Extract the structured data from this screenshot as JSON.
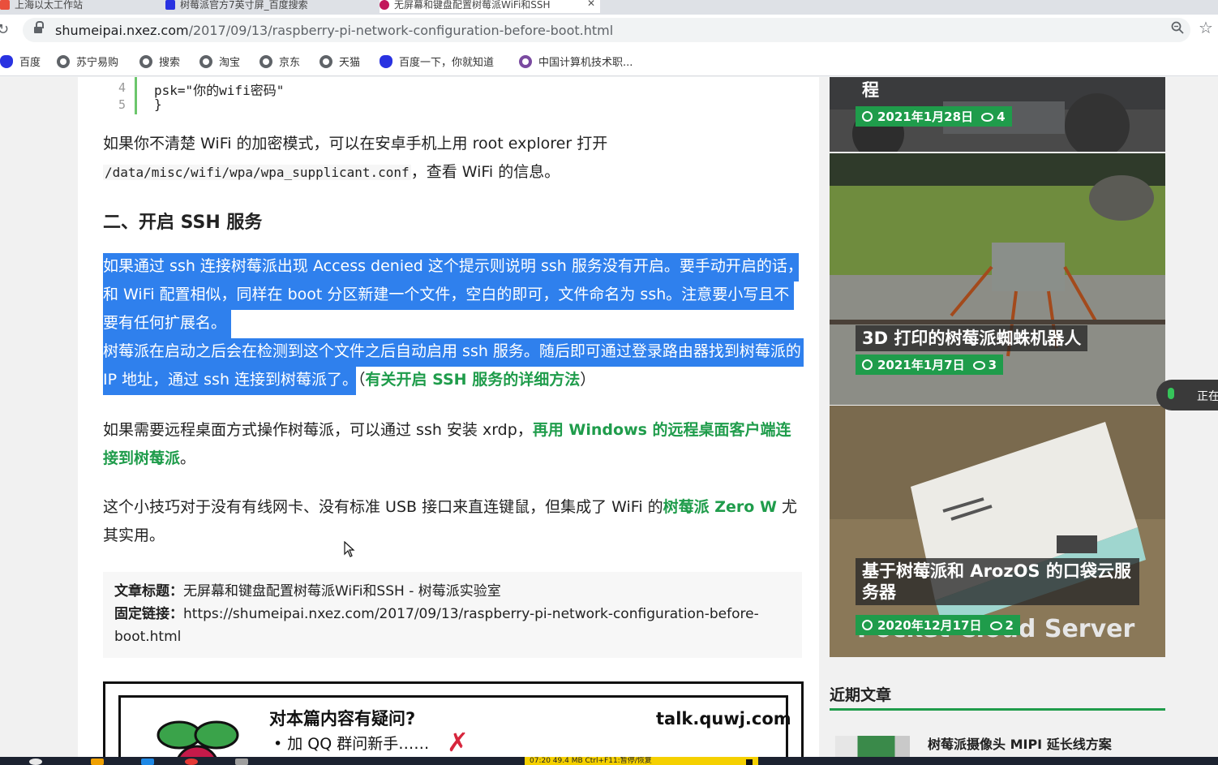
{
  "browser": {
    "tabs": [
      {
        "label": "上海以太工作站"
      },
      {
        "label": "树莓派官方7英寸屏_百度搜索"
      },
      {
        "label": "无屏幕和键盘配置树莓派WiFi和SSH"
      }
    ],
    "url_host": "shumeipai.nxez.com",
    "url_path": "/2017/09/13/raspberry-pi-network-configuration-before-boot.html",
    "bookmarks": [
      "百度",
      "苏宁易购",
      "搜索",
      "淘宝",
      "京东",
      "天猫",
      "百度一下，你就知道",
      "中国计算机技术职..."
    ]
  },
  "article": {
    "code_lines": [
      {
        "num": "4",
        "text": "psk=\"你的wifi密码\""
      },
      {
        "num": "5",
        "text": "}"
      }
    ],
    "para_wifi_1": "如果你不清楚 WiFi 的加密模式，可以在安卓手机上用 root explorer 打开",
    "para_wifi_path": "/data/misc/wifi/wpa/wpa_supplicant.conf",
    "para_wifi_2": "，查看 WiFi 的信息。",
    "heading": "二、开启 SSH 服务",
    "hl_line1": "如果通过 ssh 连接树莓派出现 Access denied 这个提示则说明 ssh 服务没有开启。要手动开启的话，",
    "hl_line2": "和 WiFi 配置相似，同样在 boot 分区新建一个文件，空白的即可，文件命名为 ssh。注意要小写且不",
    "hl_line3": "要有任何扩展名。",
    "hl_line4": "树莓派在启动之后会在检测到这个文件之后自动启用 ssh 服务。随后即可通过登录路由器找到树莓派的",
    "hl_line5": "IP 地址，通过 ssh 连接到树莓派了。",
    "ssh_link_open": "（",
    "ssh_link": "有关开启 SSH 服务的详细方法",
    "ssh_link_close": "）",
    "para_xrdp": "如果需要远程桌面方式操作树莓派，可以通过 ssh 安装 xrdp，",
    "xrdp_link": "再用 Windows 的远程桌面客户端连接到树莓派",
    "xrdp_end": "。",
    "para_tip_1": "这个小技巧对于没有有线网卡、没有标准 USB 接口来直连键鼠，但集成了 WiFi 的",
    "tip_link": "树莓派 Zero W",
    "para_tip_2": " 尤其实用。",
    "meta_title_label": "文章标题：",
    "meta_title": "无屏幕和键盘配置树莓派WiFi和SSH - 树莓派实验室",
    "meta_link_label": "固定链接：",
    "meta_link": "https://shumeipai.nxez.com/2017/09/13/raspberry-pi-network-configuration-before-boot.html",
    "question_title": "对本篇内容有疑问?",
    "question_item": "• 加 QQ 群问新手……",
    "question_site": "talk.quwj.com"
  },
  "sidebar": {
    "cards": [
      {
        "title": "程",
        "date": "2021年1月28日",
        "comments": "4"
      },
      {
        "title": "3D 打印的树莓派蜘蛛机器人",
        "date": "2021年1月7日",
        "comments": "3"
      },
      {
        "title": "基于树莓派和 ArozOS 的口袋云服务器",
        "date": "2020年12月17日",
        "comments": "2",
        "image_text": "Pocket Cloud Server"
      }
    ],
    "recent_heading": "近期文章",
    "recent_items": [
      "树莓派摄像头 MIPI 延长线方案"
    ]
  },
  "overlay": {
    "mic_label": "正在"
  },
  "recorder": {
    "status": "07:20  49.4 MB  Ctrl+F11:暂停/恢复"
  },
  "colors": {
    "accent_green": "#1f9c4b",
    "selection_blue": "#2f80ed"
  }
}
